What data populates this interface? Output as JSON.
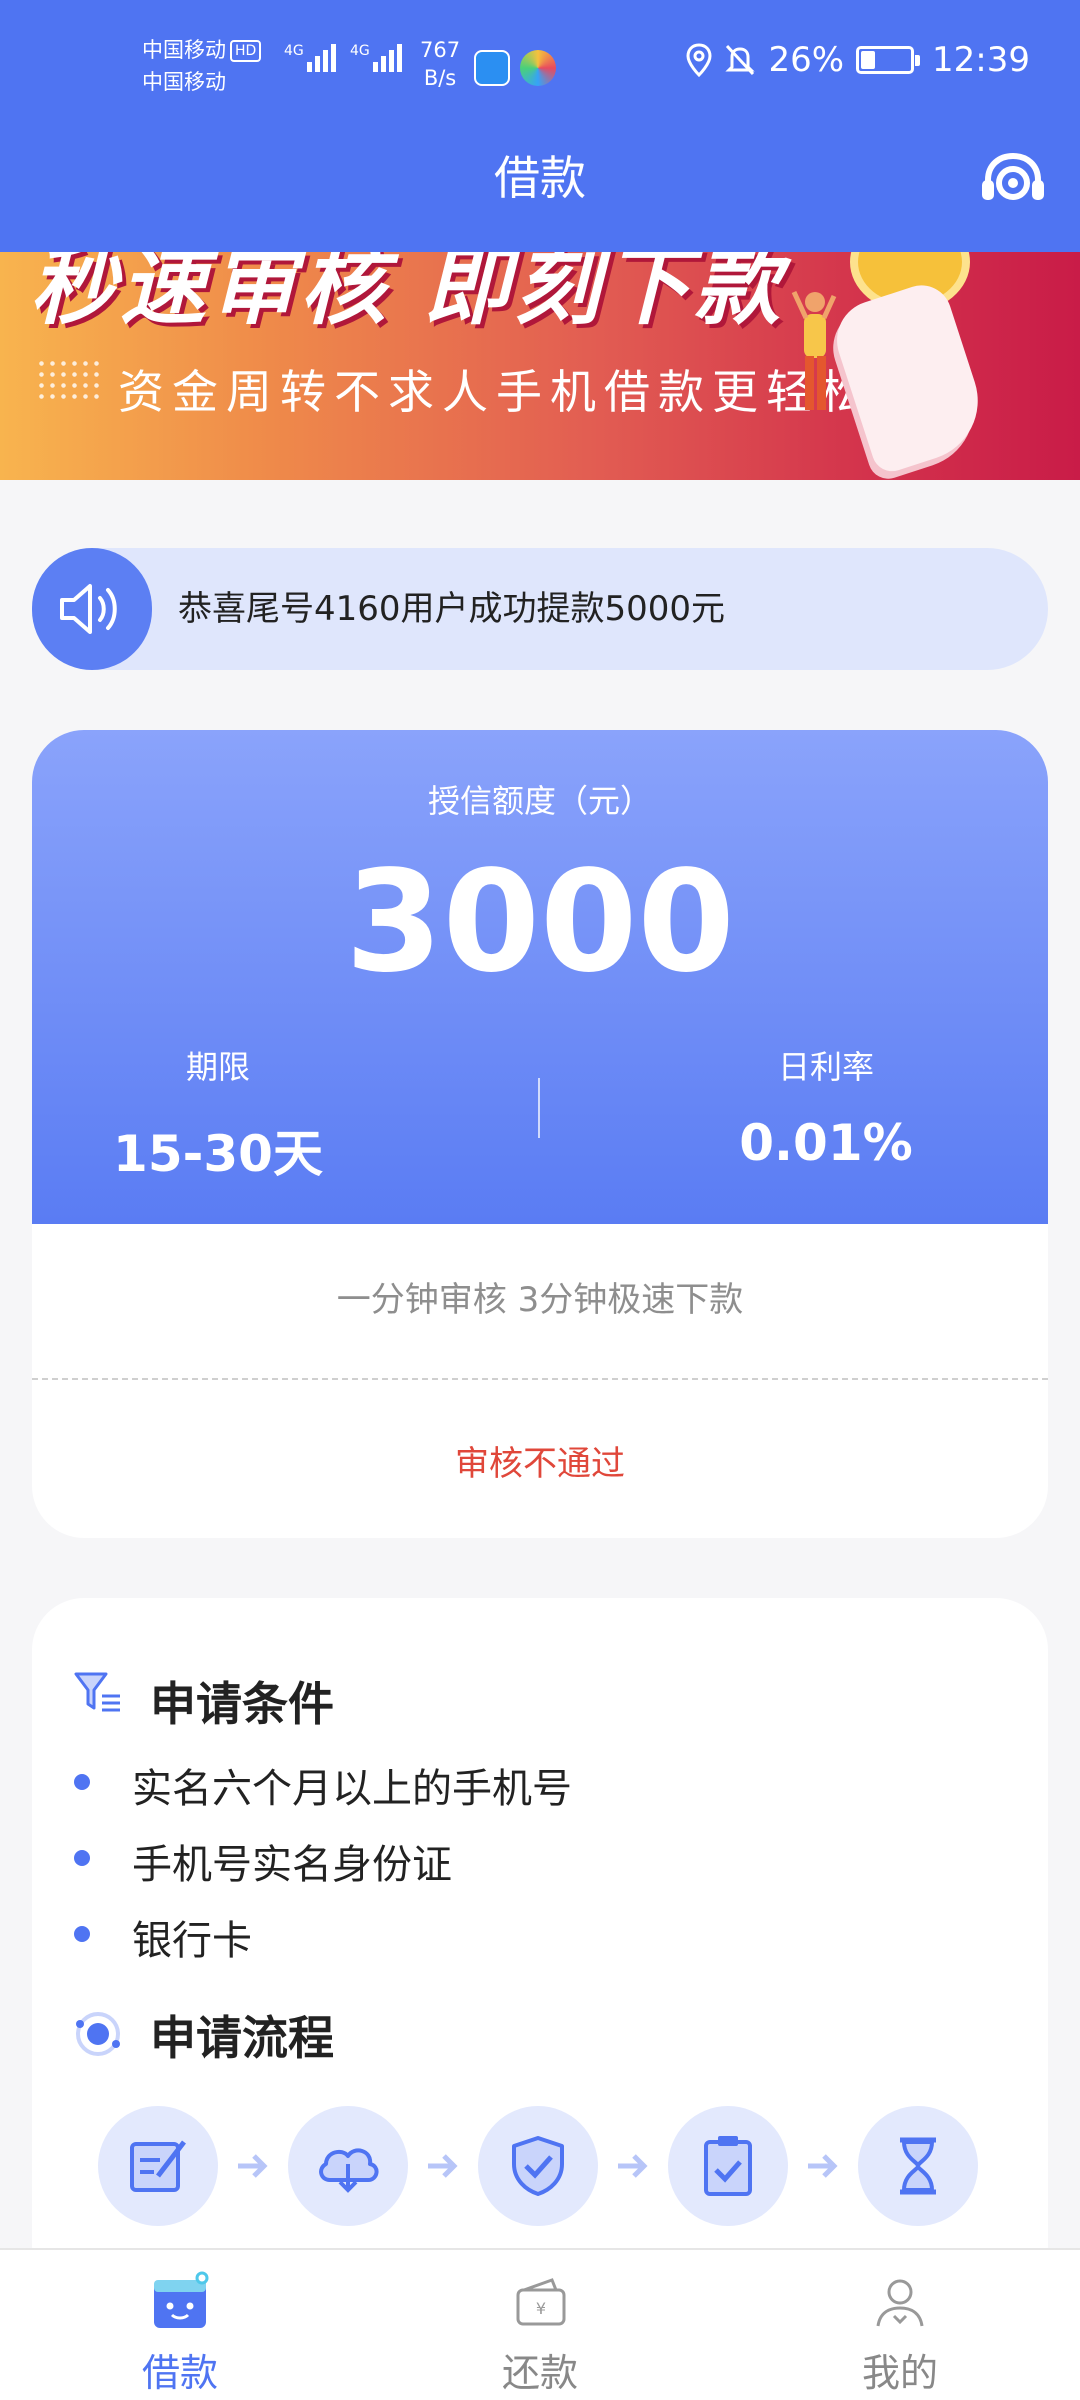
{
  "status_bar": {
    "carrier1": "中国移动",
    "carrier1_badge": "HD",
    "carrier2": "中国移动",
    "signal1_label": "4G",
    "signal2_label": "4G",
    "net_speed_value": "767",
    "net_speed_unit": "B/s",
    "battery": "26%",
    "time": "12:39"
  },
  "header": {
    "title": "借款",
    "support_icon": "customer-service-icon"
  },
  "banner": {
    "headline": "秒速审核 即刻下款",
    "subline": "资金周转不求人手机借款更轻松"
  },
  "notice": {
    "icon": "speaker-icon",
    "text": "恭喜尾号4160用户成功提款5000元"
  },
  "credit": {
    "label": "授信额度（元）",
    "amount": "3000",
    "term_label": "期限",
    "term_value": "15-30天",
    "rate_label": "日利率",
    "rate_value": "0.01%",
    "slogan": "一分钟审核 3分钟极速下款",
    "status": "审核不通过"
  },
  "conditions": {
    "title": "申请条件",
    "items": [
      "实名六个月以上的手机号",
      "手机号实名身份证",
      "银行卡"
    ]
  },
  "process": {
    "title": "申请流程",
    "steps": [
      "edit-form-icon",
      "cloud-download-icon",
      "shield-check-icon",
      "clipboard-check-icon",
      "hourglass-icon"
    ]
  },
  "tabbar": {
    "tabs": [
      {
        "label": "借款",
        "icon": "loan-icon",
        "active": true
      },
      {
        "label": "还款",
        "icon": "repay-wallet-icon",
        "active": false
      },
      {
        "label": "我的",
        "icon": "profile-icon",
        "active": false
      }
    ]
  },
  "colors": {
    "primary": "#4f74f2",
    "status_fail": "#e0473a",
    "notice_bg": "#dfe6fc"
  }
}
